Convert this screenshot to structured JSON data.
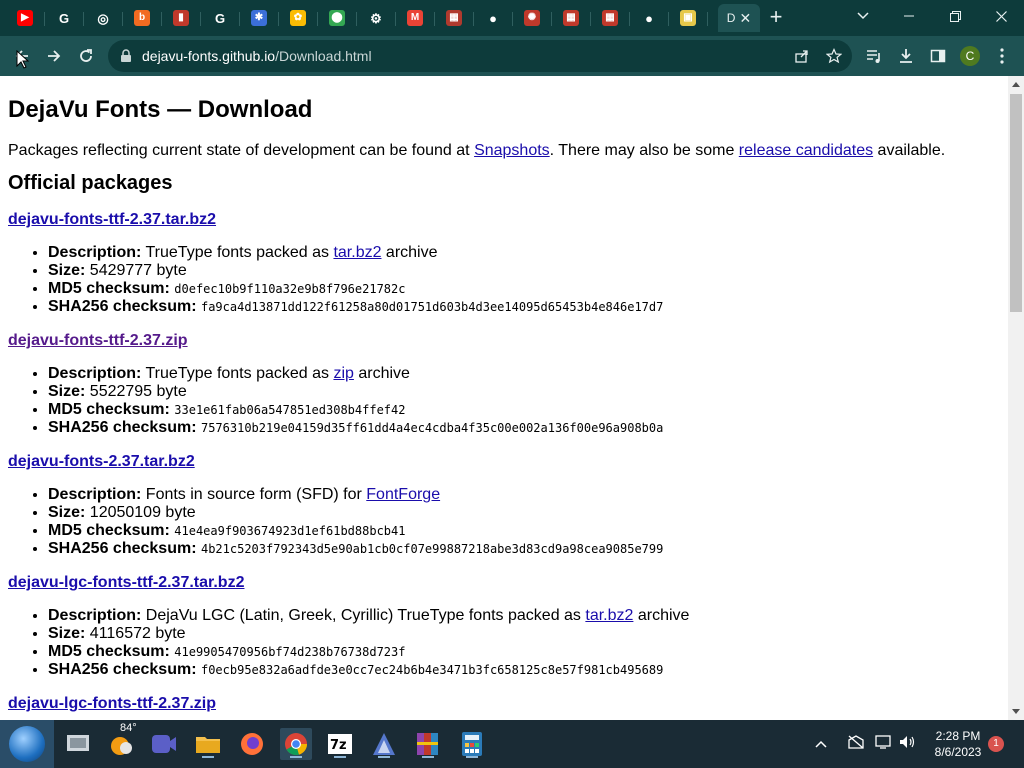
{
  "browser": {
    "tabs": [
      {
        "icon": "youtube-favicon",
        "color": "#ff0000",
        "glyph": "▶"
      },
      {
        "icon": "google-favicon",
        "color": "#ffffff",
        "glyph": "G"
      },
      {
        "icon": "chrome-favicon",
        "color": "#ffffff",
        "glyph": "◎"
      },
      {
        "icon": "blogger-favicon",
        "color": "#f26b21",
        "glyph": "b"
      },
      {
        "icon": "app-favicon",
        "color": "#c0392b",
        "glyph": "▮"
      },
      {
        "icon": "google-favicon",
        "color": "#ffffff",
        "glyph": "G"
      },
      {
        "icon": "site-favicon",
        "color": "#3b6fd8",
        "glyph": "✱"
      },
      {
        "icon": "photos-favicon",
        "color": "#fbbc04",
        "glyph": "✿"
      },
      {
        "icon": "maps-favicon",
        "color": "#34a853",
        "glyph": "⬤"
      },
      {
        "icon": "settings-favicon",
        "color": "#ffffff",
        "glyph": "⚙"
      },
      {
        "icon": "gmail-favicon",
        "color": "#ea4335",
        "glyph": "M"
      },
      {
        "icon": "grid-favicon",
        "color": "#b03a2e",
        "glyph": "▦"
      },
      {
        "icon": "github-favicon",
        "color": "#ffffff",
        "glyph": "●"
      },
      {
        "icon": "asterisk-favicon",
        "color": "#c0392b",
        "glyph": "✺"
      },
      {
        "icon": "red-app-favicon",
        "color": "#c0392b",
        "glyph": "▦"
      },
      {
        "icon": "red-app-favicon",
        "color": "#c0392b",
        "glyph": "▦"
      },
      {
        "icon": "github-favicon",
        "color": "#ffffff",
        "glyph": "●"
      },
      {
        "icon": "image-favicon",
        "color": "#e6c84a",
        "glyph": "▣"
      }
    ],
    "active_tab_label": "D",
    "new_tab_label": "+",
    "url_host": "dejavu-fonts.github.io",
    "url_path": "/Download.html",
    "profile_initial": "C"
  },
  "page": {
    "title": "DejaVu Fonts — Download",
    "intro": {
      "prefix": "Packages reflecting current state of development can be found at ",
      "snapshots_link": "Snapshots",
      "middle": ". There may also be some ",
      "rc_link": "release candidates",
      "suffix": " available."
    },
    "section_title": "Official packages",
    "labels": {
      "description": "Description:",
      "size": "Size:",
      "md5": "MD5 checksum:",
      "sha256": "SHA256 checksum:"
    },
    "packages": [
      {
        "name": "dejavu-fonts-ttf-2.37.tar.bz2",
        "desc_prefix": " TrueType fonts packed as ",
        "desc_link": "tar.bz2",
        "desc_suffix": " archive",
        "size": " 5429777 byte",
        "md5": "d0efec10b9f110a32e9b8f796e21782c",
        "sha256": "fa9ca4d13871dd122f61258a80d01751d603b4d3ee14095d65453b4e846e17d7"
      },
      {
        "name": "dejavu-fonts-ttf-2.37.zip",
        "desc_prefix": " TrueType fonts packed as ",
        "desc_link": "zip",
        "desc_suffix": " archive",
        "size": " 5522795 byte",
        "md5": "33e1e61fab06a547851ed308b4ffef42",
        "sha256": "7576310b219e04159d35ff61dd4a4ec4cdba4f35c00e002a136f00e96a908b0a"
      },
      {
        "name": "dejavu-fonts-2.37.tar.bz2",
        "desc_prefix": " Fonts in source form (SFD) for ",
        "desc_link": "FontForge",
        "desc_suffix": "",
        "size": " 12050109 byte",
        "md5": "41e4ea9f903674923d1ef61bd88bcb41",
        "sha256": "4b21c5203f792343d5e90ab1cb0cf07e99887218abe3d83cd9a98cea9085e799"
      },
      {
        "name": "dejavu-lgc-fonts-ttf-2.37.tar.bz2",
        "desc_prefix": " DejaVu LGC (Latin, Greek, Cyrillic) TrueType fonts packed as ",
        "desc_link": "tar.bz2",
        "desc_suffix": " archive",
        "size": " 4116572 byte",
        "md5": "41e9905470956bf74d238b76738d723f",
        "sha256": "f0ecb95e832a6adfde3e0cc7ec24b6b4e3471b3fc658125c8e57f981cb495689"
      }
    ],
    "next_package_partial": "dejavu-lgc-fonts-ttf-2.37.zip"
  },
  "taskbar": {
    "weather": "84°",
    "time": "2:28 PM",
    "date": "8/6/2023",
    "notification_count": "1",
    "colors": {
      "bar": "#1a2b35",
      "start": "#2a4d68"
    }
  }
}
